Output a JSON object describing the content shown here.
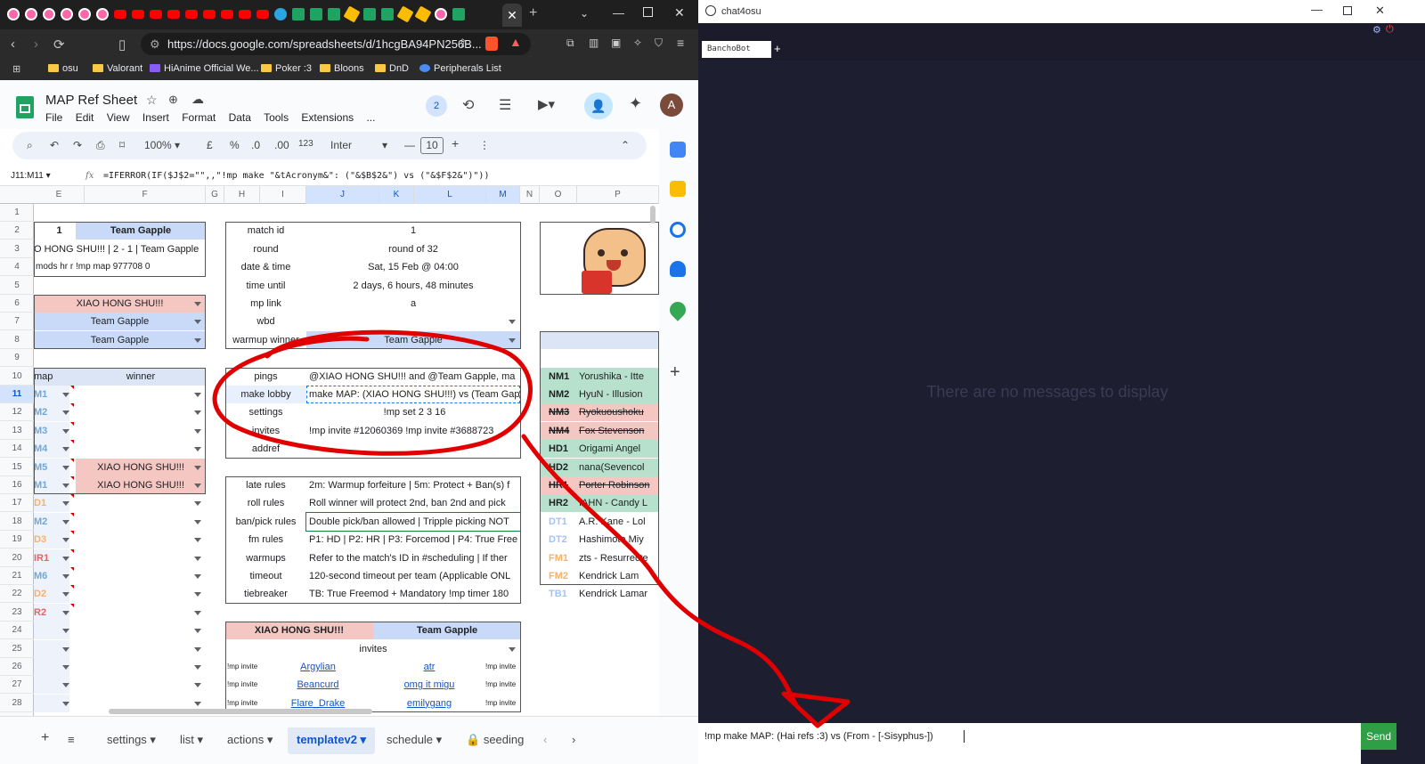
{
  "browser": {
    "url": "https://docs.google.com/spreadsheets/d/1hcgBA94PN256B...",
    "bookmarks": [
      "osu",
      "Valorant",
      "HiAnime Official We...",
      "Poker :3",
      "Bloons",
      "DnD",
      "Peripherals List"
    ]
  },
  "sheet": {
    "title": "MAP Ref Sheet",
    "menus": [
      "File",
      "Edit",
      "View",
      "Insert",
      "Format",
      "Data",
      "Tools",
      "Extensions",
      "..."
    ],
    "collaborators": "2",
    "avatar": "A",
    "toolbar": {
      "zoom": "100%",
      "currency": "£",
      "percent": "%",
      "dec_minus": ".0",
      "dec_plus": ".00",
      "number_format": "123",
      "font": "Inter",
      "font_size": "10"
    },
    "name_box": "J11:M11",
    "formula": "=IFERROR(IF($J$2=\"\",,\"!mp make \"&tAcronym&\": (\"&$B$2&\") vs (\"&$F$2&\")\"))",
    "columns": [
      "E",
      "F",
      "G",
      "H",
      "I",
      "J",
      "K",
      "L",
      "M",
      "N",
      "O",
      "P"
    ],
    "rows": [
      "1",
      "2",
      "3",
      "4",
      "5",
      "6",
      "7",
      "8",
      "9",
      "10",
      "11",
      "12",
      "13",
      "14",
      "15",
      "16",
      "17",
      "18",
      "19",
      "20",
      "21",
      "22",
      "23",
      "24",
      "25",
      "26",
      "27",
      "28"
    ],
    "team_block": {
      "num": "1",
      "team": "Team Gapple",
      "score": "O HONG SHU!!! | 2 - 1 | Team Gapple",
      "mods": "mods hr r !mp map 977708 0",
      "pick1": "XIAO HONG SHU!!!",
      "pick2": "Team Gapple",
      "pick3": "Team Gapple"
    },
    "map_winner": {
      "head_map": "map",
      "head_winner": "winner",
      "maps": [
        "M1",
        "M2",
        "M3",
        "M4",
        "M5",
        "M1",
        "D1",
        "M2",
        "D3",
        "IR1",
        "M6",
        "D2",
        "R2"
      ],
      "winner_15": "XIAO HONG SHU!!!",
      "winner_16": "XIAO HONG SHU!!!"
    },
    "info": [
      {
        "label": "match id",
        "value": "1"
      },
      {
        "label": "round",
        "value": "round of 32"
      },
      {
        "label": "date & time",
        "value": "Sat, 15 Feb @ 04:00"
      },
      {
        "label": "time until",
        "value": "2 days, 6 hours, 48 minutes"
      },
      {
        "label": "mp link",
        "value": "a"
      },
      {
        "label": "wbd",
        "value": ""
      },
      {
        "label": "warmup winner",
        "value": "Team Gapple"
      }
    ],
    "commands": [
      {
        "label": "pings",
        "value": "@XIAO HONG SHU!!! and @Team Gapple, ma"
      },
      {
        "label": "make lobby",
        "value": "make MAP: (XIAO HONG SHU!!!) vs (Team Gap"
      },
      {
        "label": "settings",
        "value": "!mp set 2 3 16"
      },
      {
        "label": "invites",
        "value": "!mp invite #12060369  !mp invite #3688723"
      },
      {
        "label": "addref",
        "value": ""
      }
    ],
    "rules": [
      {
        "label": "late rules",
        "value": "2m: Warmup forfeiture | 5m: Protect + Ban(s) f"
      },
      {
        "label": "roll rules",
        "value": "Roll winner will protect 2nd, ban 2nd and pick"
      },
      {
        "label": "ban/pick rules",
        "value": "Double pick/ban allowed | Tripple picking NOT"
      },
      {
        "label": "fm rules",
        "value": "P1: HD | P2: HR | P3: Forcemod | P4: True Free"
      },
      {
        "label": "warmups",
        "value": "Refer to the match's ID in #scheduling | If ther"
      },
      {
        "label": "timeout",
        "value": "120-second timeout per team (Applicable ONL"
      },
      {
        "label": "tiebreaker",
        "value": "TB: True Freemod + Mandatory !mp timer 180"
      }
    ],
    "invites": {
      "team1": "XIAO HONG SHU!!!",
      "team2": "Team Gapple",
      "label": "invites",
      "prefix": "!mp invite",
      "left": [
        "Argylian",
        "Beancurd",
        "Flare_Drake"
      ],
      "right": [
        "atr",
        "omg it migu",
        "emilygang"
      ]
    },
    "mappool": [
      {
        "code": "NM1",
        "title": "Yorushika - Itte",
        "color": "#b7e1cd",
        "strike": false
      },
      {
        "code": "NM2",
        "title": "HyuN - Illusion",
        "color": "#b7e1cd",
        "strike": false
      },
      {
        "code": "NM3",
        "title": "Ryokuoushoku",
        "color": "#f4c7c3",
        "strike": true
      },
      {
        "code": "NM4",
        "title": "Fox Stevenson",
        "color": "#f4c7c3",
        "strike": true
      },
      {
        "code": "HD1",
        "title": "Origami Angel",
        "color": "#b7e1cd",
        "strike": false
      },
      {
        "code": "HD2",
        "title": "nana(Sevencol",
        "color": "#b7e1cd",
        "strike": false
      },
      {
        "code": "HR1",
        "title": "Porter Robinson",
        "color": "#f4c7c3",
        "strike": true
      },
      {
        "code": "HR2",
        "title": "IAHN - Candy L",
        "color": "#b7e1cd",
        "strike": false
      },
      {
        "code": "DT1",
        "title": "A.R. Kane - Lol",
        "color": "",
        "strike": false
      },
      {
        "code": "DT2",
        "title": "Hashimoto Miy",
        "color": "",
        "strike": false
      },
      {
        "code": "FM1",
        "title": "zts - Resurrecte",
        "color": "",
        "strike": false
      },
      {
        "code": "FM2",
        "title": "Kendrick Lam",
        "color": "",
        "strike": false
      },
      {
        "code": "TB1",
        "title": "Kendrick Lamar",
        "color": "",
        "strike": false
      }
    ],
    "sheet_tabs": [
      "settings",
      "list",
      "actions",
      "templatev2",
      "schedule",
      "seeding"
    ]
  },
  "chat": {
    "window_title": "chat4osu",
    "tab": "BanchoBot",
    "add_tab": "+",
    "empty_message": "There are no messages to display",
    "input_value": "!mp make MAP: (Hai refs :3) vs (From - [-Sisyphus-])",
    "send_label": "Send"
  },
  "colors": {
    "team1": "#f4c7c3",
    "team2": "#c9daf8",
    "annotation": "#e00000",
    "send": "#2e9f45"
  }
}
